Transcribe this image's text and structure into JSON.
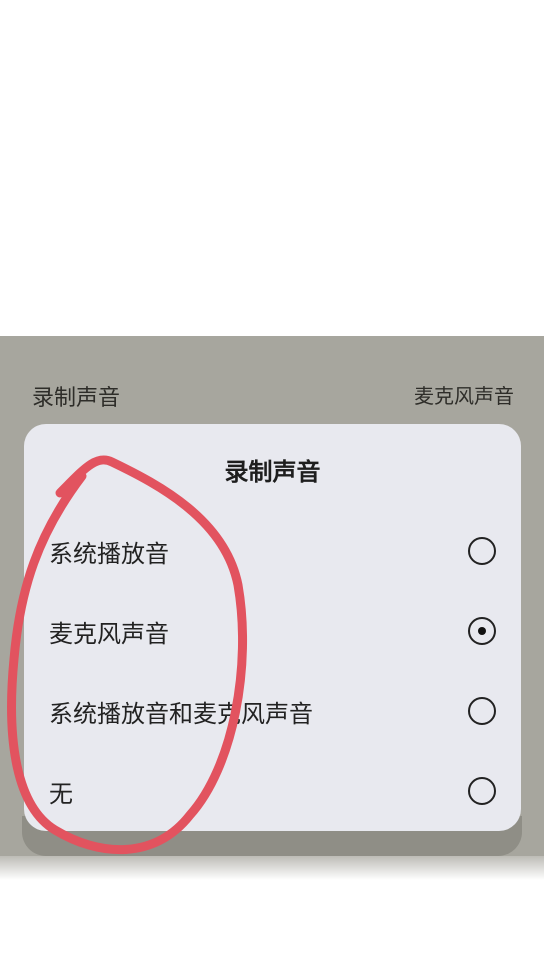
{
  "settings": {
    "label": "录制声音",
    "value": "麦克风声音"
  },
  "dialog": {
    "title": "录制声音",
    "options": [
      {
        "label": "系统播放音",
        "selected": false
      },
      {
        "label": "麦克风声音",
        "selected": true
      },
      {
        "label": "系统播放音和麦克风声音",
        "selected": false
      },
      {
        "label": "无",
        "selected": false
      }
    ]
  },
  "annotation": {
    "color": "#e2535f",
    "icon": "red-circle-annotation"
  }
}
